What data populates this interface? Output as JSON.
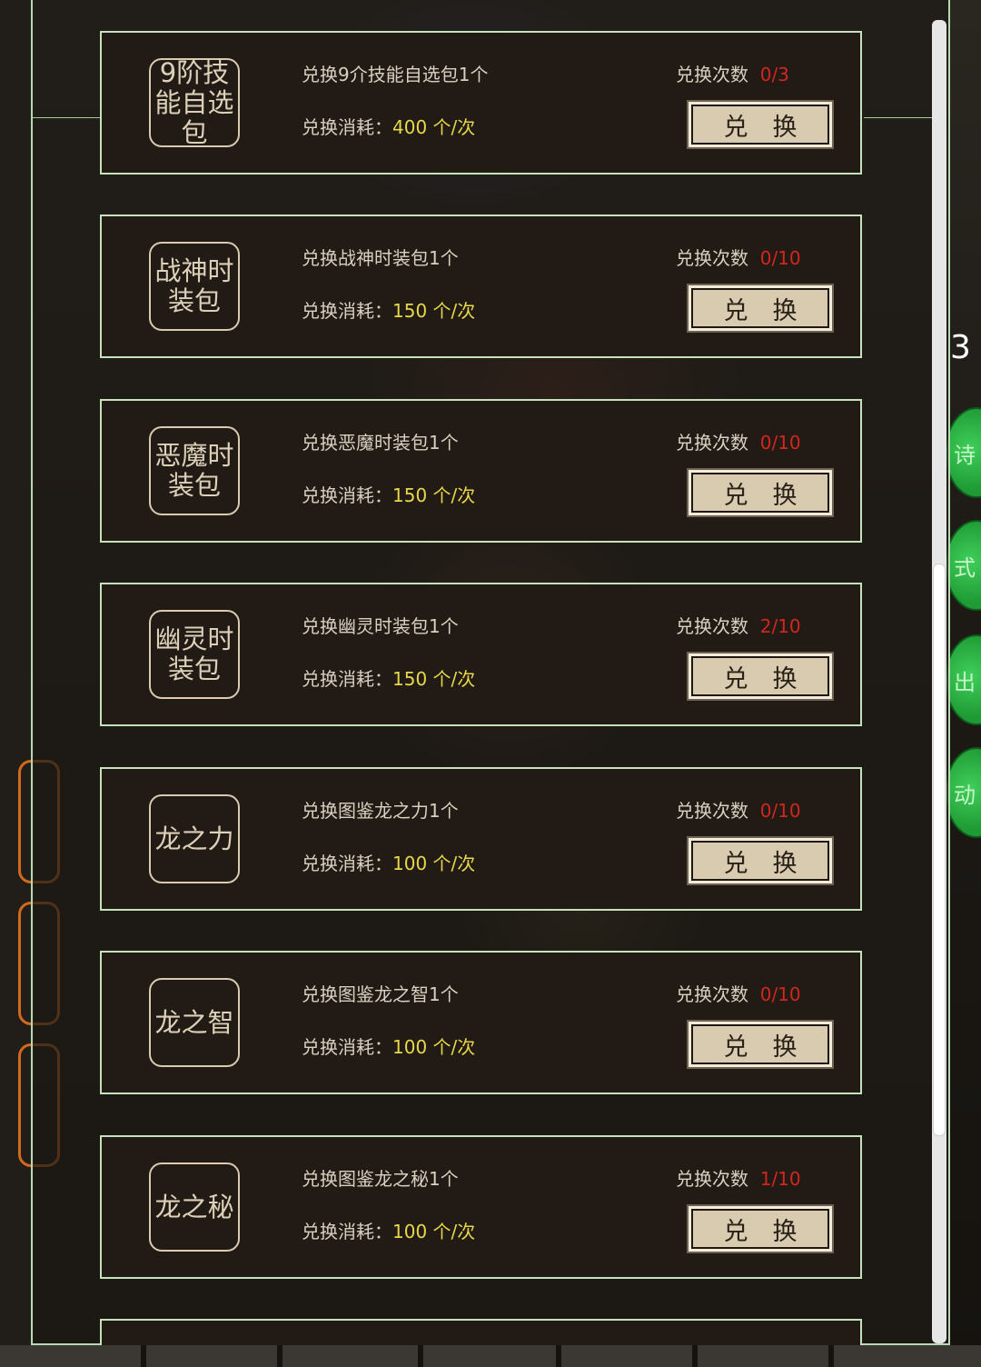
{
  "side_number": "3",
  "side_buttons": [
    {
      "label": "诗"
    },
    {
      "label": "式"
    },
    {
      "label": "出"
    },
    {
      "label": "动"
    }
  ],
  "exchange": {
    "count_label": "兑换次数",
    "cost_label": "兑换消耗：",
    "button_label": "兑　换",
    "items": [
      {
        "icon_text": "9阶技能自选包",
        "desc": "兑换9介技能自选包1个",
        "cost": "400 个/次",
        "count": "0/3"
      },
      {
        "icon_text": "战神时装包",
        "desc": "兑换战神时装包1个",
        "cost": "150 个/次",
        "count": "0/10"
      },
      {
        "icon_text": "恶魔时装包",
        "desc": "兑换恶魔时装包1个",
        "cost": "150 个/次",
        "count": "0/10"
      },
      {
        "icon_text": "幽灵时装包",
        "desc": "兑换幽灵时装包1个",
        "cost": "150 个/次",
        "count": "2/10"
      },
      {
        "icon_text": "龙之力",
        "desc": "兑换图鉴龙之力1个",
        "cost": "100 个/次",
        "count": "0/10"
      },
      {
        "icon_text": "龙之智",
        "desc": "兑换图鉴龙之智1个",
        "cost": "100 个/次",
        "count": "0/10"
      },
      {
        "icon_text": "龙之秘",
        "desc": "兑换图鉴龙之秘1个",
        "cost": "100 个/次",
        "count": "1/10"
      }
    ]
  },
  "colors": {
    "card_border": "#c6e2bd",
    "cost_value": "#e8d84a",
    "count_value": "#d2261e",
    "button_bg": "#d9cbb0"
  }
}
